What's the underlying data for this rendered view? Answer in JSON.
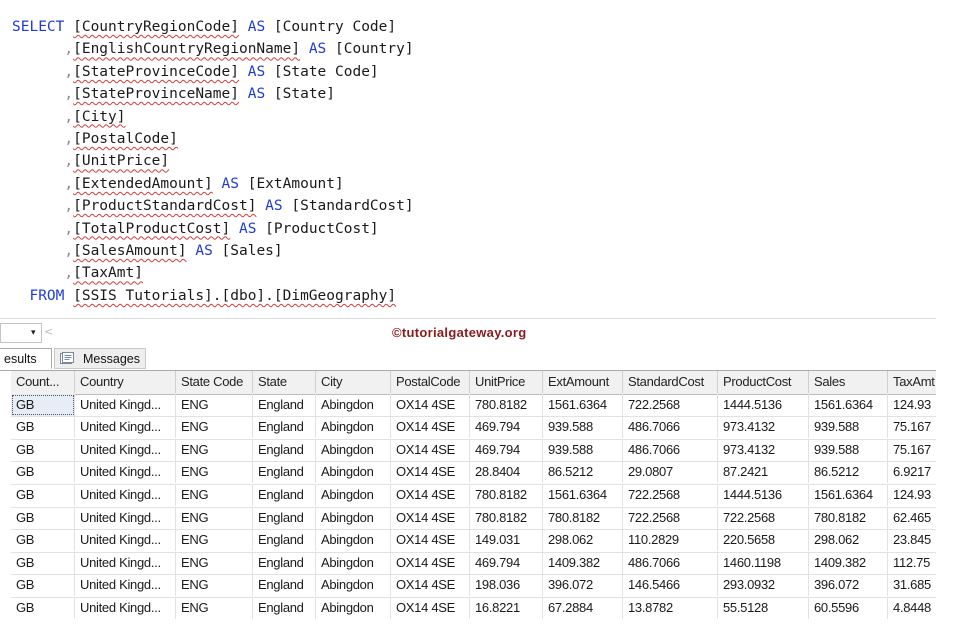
{
  "editor": {
    "lines": [
      [
        {
          "t": "SELECT ",
          "c": "kw"
        },
        {
          "t": "[CountryRegionCode]",
          "c": "plain",
          "u": true
        },
        {
          "t": " AS ",
          "c": "kw"
        },
        {
          "t": "[Country Code]",
          "c": "plain"
        }
      ],
      [
        {
          "t": "      ,",
          "c": "gray"
        },
        {
          "t": "[EnglishCountryRegionName]",
          "c": "plain",
          "u": true
        },
        {
          "t": " AS ",
          "c": "kw"
        },
        {
          "t": "[Country]",
          "c": "plain"
        }
      ],
      [
        {
          "t": "      ,",
          "c": "gray"
        },
        {
          "t": "[StateProvinceCode]",
          "c": "plain",
          "u": true
        },
        {
          "t": " AS ",
          "c": "kw"
        },
        {
          "t": "[State Code]",
          "c": "plain"
        }
      ],
      [
        {
          "t": "      ,",
          "c": "gray"
        },
        {
          "t": "[StateProvinceName]",
          "c": "plain",
          "u": true
        },
        {
          "t": " AS ",
          "c": "kw"
        },
        {
          "t": "[State]",
          "c": "plain"
        }
      ],
      [
        {
          "t": "      ,",
          "c": "gray"
        },
        {
          "t": "[City]",
          "c": "plain",
          "u": true
        }
      ],
      [
        {
          "t": "      ,",
          "c": "gray"
        },
        {
          "t": "[PostalCode]",
          "c": "plain",
          "u": true
        }
      ],
      [
        {
          "t": "      ,",
          "c": "gray"
        },
        {
          "t": "[UnitPrice]",
          "c": "plain",
          "u": true
        }
      ],
      [
        {
          "t": "      ,",
          "c": "gray"
        },
        {
          "t": "[ExtendedAmount]",
          "c": "plain",
          "u": true
        },
        {
          "t": " AS ",
          "c": "kw"
        },
        {
          "t": "[ExtAmount]",
          "c": "plain"
        }
      ],
      [
        {
          "t": "      ,",
          "c": "gray"
        },
        {
          "t": "[ProductStandardCost]",
          "c": "plain",
          "u": true
        },
        {
          "t": " AS ",
          "c": "kw"
        },
        {
          "t": "[StandardCost]",
          "c": "plain"
        }
      ],
      [
        {
          "t": "      ,",
          "c": "gray"
        },
        {
          "t": "[TotalProductCost]",
          "c": "plain",
          "u": true
        },
        {
          "t": " AS ",
          "c": "kw"
        },
        {
          "t": "[ProductCost]",
          "c": "plain"
        }
      ],
      [
        {
          "t": "      ,",
          "c": "gray"
        },
        {
          "t": "[SalesAmount]",
          "c": "plain",
          "u": true
        },
        {
          "t": " AS ",
          "c": "kw"
        },
        {
          "t": "[Sales]",
          "c": "plain"
        }
      ],
      [
        {
          "t": "      ,",
          "c": "gray"
        },
        {
          "t": "[TaxAmt]",
          "c": "plain",
          "u": true
        }
      ],
      [
        {
          "t": "  FROM ",
          "c": "kw"
        },
        {
          "t": "[SSIS Tutorials].[dbo].[DimGeography]",
          "c": "plain",
          "u": true
        }
      ]
    ]
  },
  "splitter": {
    "combo_arrow": "▾",
    "scroll_glyph": "<",
    "watermark": "©tutorialgateway.org"
  },
  "tabs": {
    "results_label": "esults",
    "messages_label": "Messages",
    "messages_icon": "messages-icon"
  },
  "grid": {
    "columns": [
      "Count...",
      "Country",
      "State Code",
      "State",
      "City",
      "PostalCode",
      "UnitPrice",
      "ExtAmount",
      "StandardCost",
      "ProductCost",
      "Sales",
      "TaxAmt"
    ],
    "rows": [
      [
        "GB",
        "United Kingd...",
        "ENG",
        "England",
        "Abingdon",
        "OX14 4SE",
        "780.8182",
        "1561.6364",
        "722.2568",
        "1444.5136",
        "1561.6364",
        "124.93"
      ],
      [
        "GB",
        "United Kingd...",
        "ENG",
        "England",
        "Abingdon",
        "OX14 4SE",
        "469.794",
        "939.588",
        "486.7066",
        "973.4132",
        "939.588",
        "75.167"
      ],
      [
        "GB",
        "United Kingd...",
        "ENG",
        "England",
        "Abingdon",
        "OX14 4SE",
        "469.794",
        "939.588",
        "486.7066",
        "973.4132",
        "939.588",
        "75.167"
      ],
      [
        "GB",
        "United Kingd...",
        "ENG",
        "England",
        "Abingdon",
        "OX14 4SE",
        "28.8404",
        "86.5212",
        "29.0807",
        "87.2421",
        "86.5212",
        "6.9217"
      ],
      [
        "GB",
        "United Kingd...",
        "ENG",
        "England",
        "Abingdon",
        "OX14 4SE",
        "780.8182",
        "1561.6364",
        "722.2568",
        "1444.5136",
        "1561.6364",
        "124.93"
      ],
      [
        "GB",
        "United Kingd...",
        "ENG",
        "England",
        "Abingdon",
        "OX14 4SE",
        "780.8182",
        "780.8182",
        "722.2568",
        "722.2568",
        "780.8182",
        "62.465"
      ],
      [
        "GB",
        "United Kingd...",
        "ENG",
        "England",
        "Abingdon",
        "OX14 4SE",
        "149.031",
        "298.062",
        "110.2829",
        "220.5658",
        "298.062",
        "23.845"
      ],
      [
        "GB",
        "United Kingd...",
        "ENG",
        "England",
        "Abingdon",
        "OX14 4SE",
        "469.794",
        "1409.382",
        "486.7066",
        "1460.1198",
        "1409.382",
        "112.75"
      ],
      [
        "GB",
        "United Kingd...",
        "ENG",
        "England",
        "Abingdon",
        "OX14 4SE",
        "198.036",
        "396.072",
        "146.5466",
        "293.0932",
        "396.072",
        "31.685"
      ],
      [
        "GB",
        "United Kingd...",
        "ENG",
        "England",
        "Abingdon",
        "OX14 4SE",
        "16.8221",
        "67.2884",
        "13.8782",
        "55.5128",
        "60.5596",
        "4.8448"
      ]
    ]
  }
}
